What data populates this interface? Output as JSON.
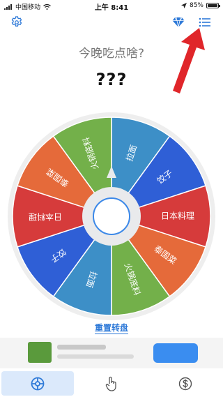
{
  "status": {
    "carrier": "中国移动",
    "time": "上午 8:41",
    "battery": "85%"
  },
  "header": {
    "question": "今晚吃点啥?",
    "result": "???"
  },
  "wheel": {
    "segments": [
      {
        "label": "拉面",
        "color": "#3d8fc7"
      },
      {
        "label": "饺子",
        "color": "#2f5fd6"
      },
      {
        "label": "日本料理",
        "color": "#d63b3b"
      },
      {
        "label": "泰国菜",
        "color": "#e56a3a"
      },
      {
        "label": "火锅底料",
        "color": "#73b04a"
      },
      {
        "label": "拉面",
        "color": "#3d8fc7"
      },
      {
        "label": "饺子",
        "color": "#2f5fd6"
      },
      {
        "label": "日本料理",
        "color": "#d63b3b"
      },
      {
        "label": "泰国菜",
        "color": "#e56a3a"
      },
      {
        "label": "火锅底料",
        "color": "#73b04a"
      }
    ]
  },
  "actions": {
    "reset_label": "重置转盘"
  },
  "colors": {
    "accent": "#2f7ad8",
    "arrow": "#e0262a"
  },
  "icons": {
    "settings": "gear-icon",
    "gem": "diamond-icon",
    "list": "list-icon",
    "tab1": "wheel-icon",
    "tab2": "tap-hand-icon",
    "tab3": "dollar-icon"
  }
}
